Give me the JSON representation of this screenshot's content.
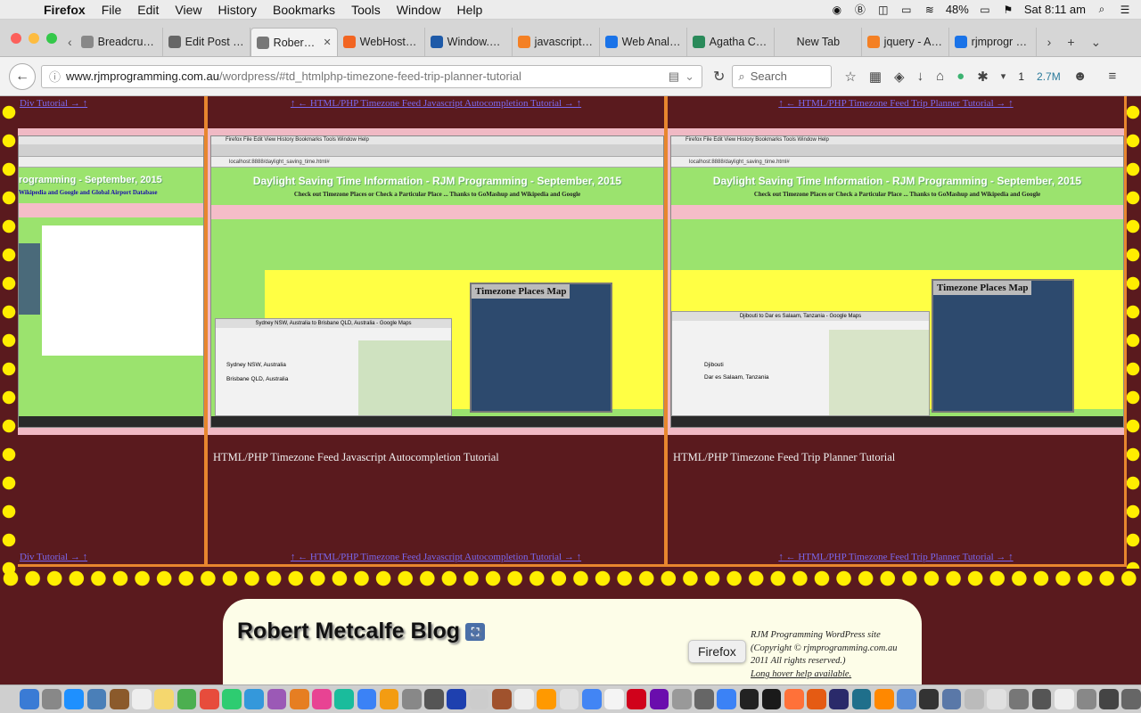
{
  "menubar": {
    "app": "Firefox",
    "items": [
      "File",
      "Edit",
      "View",
      "History",
      "Bookmarks",
      "Tools",
      "Window",
      "Help"
    ],
    "battery": "48%",
    "clock": "Sat 8:11 am"
  },
  "tabs": [
    {
      "title": "Breadcru…",
      "color": "#888"
    },
    {
      "title": "Edit Post …",
      "color": "#666"
    },
    {
      "title": "Rober…",
      "color": "#777",
      "active": true
    },
    {
      "title": "WebHost…",
      "color": "#f26522"
    },
    {
      "title": "Window.…",
      "color": "#1e5aa8"
    },
    {
      "title": "javascript…",
      "color": "#f48024"
    },
    {
      "title": "Web Anal…",
      "color": "#1a73e8"
    },
    {
      "title": "Agatha C…",
      "color": "#2a8a5a"
    },
    {
      "title": "New Tab",
      "color": "#d6d6d6"
    },
    {
      "title": "jquery - A…",
      "color": "#f48024"
    },
    {
      "title": "rjmprogr …",
      "color": "#1a73e8"
    }
  ],
  "nav": {
    "url_host": "www.rjmprogramming.com.au",
    "url_path": "/wordpress/#td_htmlphp-timezone-feed-trip-planner-tutorial",
    "search_placeholder": "Search",
    "download_badge": "1",
    "memory": "2.7M"
  },
  "panels": [
    {
      "top_link": "Div Tutorial → ↑",
      "bottom_link": "Div Tutorial → ↑",
      "caption": "",
      "shot": {
        "title": "rogramming - September, 2015",
        "sub": "Wikipedia and Google and Global Airport Database"
      }
    },
    {
      "top_link": "↑ ← HTML/PHP Timezone Feed Javascript Autocompletion Tutorial → ↑",
      "bottom_link": "↑ ← HTML/PHP Timezone Feed Javascript Autocompletion Tutorial → ↑",
      "caption": "HTML/PHP Timezone Feed Javascript Autocompletion Tutorial",
      "shot": {
        "title": "Daylight Saving Time Information - RJM Programming - September, 2015",
        "sub": "Check out Timezone Places or Check a Particular Place ... Thanks to GoMashup and Wikipedia and Google",
        "map_title": "Timezone Places Map",
        "gmap_title": "Sydney NSW, Australia to Brisbane QLD, Australia - Google Maps",
        "from": "Sydney NSW, Australia",
        "to": "Brisbane QLD, Australia"
      }
    },
    {
      "top_link": "↑ ← HTML/PHP Timezone Feed Trip Planner Tutorial → ↑",
      "bottom_link": "↑ ← HTML/PHP Timezone Feed Trip Planner Tutorial → ↑",
      "caption": "HTML/PHP Timezone Feed Trip Planner Tutorial",
      "shot": {
        "title": "Daylight Saving Time Information - RJM Programming - September, 2015",
        "sub": "Check out Timezone Places or Check a Particular Place ... Thanks to GoMashup and Wikipedia and Google",
        "map_title": "Timezone Places Map",
        "gmap_title": "Djibouti to Dar es Salaam, Tanzania - Google Maps",
        "from": "Djibouti",
        "to": "Dar es Salaam, Tanzania"
      }
    }
  ],
  "footer": {
    "blog_title": "Robert Metcalfe Blog",
    "copyright_1": "RJM Programming WordPress site",
    "copyright_2": "(Copyright © rjmprogramming.com.au",
    "copyright_3": "2011 All rights reserved.)",
    "help_link": "Long hover help available."
  },
  "tooltip": "Firefox",
  "colors": {
    "page_bg": "#5a1a1e",
    "dots": "#ffee00",
    "panel_border": "#e8862e",
    "link": "#7b68ee"
  }
}
